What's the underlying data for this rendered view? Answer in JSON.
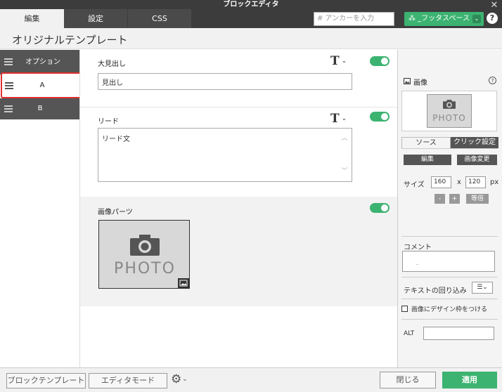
{
  "window": {
    "title": "ブロックエディタ",
    "close_glyph": "✕"
  },
  "tabs": [
    {
      "label": "編集",
      "active": true
    },
    {
      "label": "設定",
      "active": false
    },
    {
      "label": "CSS",
      "active": false
    }
  ],
  "anchor": {
    "placeholder": "# アンカーを入力"
  },
  "footer_space": {
    "label": "⁂ _フッタスペース",
    "chevron": "⌄"
  },
  "help_glyph": "?",
  "page_title": "オリジナルテンプレート",
  "sidebar": {
    "items": [
      {
        "label": "オプション",
        "active": false
      },
      {
        "label": "A",
        "active": true
      },
      {
        "label": "B",
        "active": false
      }
    ]
  },
  "fields": {
    "heading": {
      "label": "大見出し",
      "value": "見出し",
      "enabled": true
    },
    "lead": {
      "label": "リード",
      "value": "リード文",
      "enabled": true
    },
    "image": {
      "label": "画像パーツ",
      "placeholder_text": "PHOTO",
      "enabled": true
    }
  },
  "text_format": {
    "glyph": "T",
    "chevron": "⌄"
  },
  "right_panel": {
    "title": "画像",
    "help_glyph": "?",
    "thumbnail_text": "PHOTO",
    "tabs": {
      "source": "ソース",
      "click": "クリック設定"
    },
    "edit_button": "編集",
    "change_button": "画像変更",
    "size_label": "サイズ",
    "width": "160",
    "x_label": "x",
    "height": "120",
    "unit": "px",
    "minus": "-",
    "plus": "+",
    "equal_scale": "等倍",
    "comment_label": "コメント",
    "comment_value": "..",
    "wrap_label": "テキストの回り込み",
    "wrap_glyph": "☰⌄",
    "frame_label": "画像にデザイン枠をつける",
    "frame_checked": false,
    "alt_label": "ALT",
    "alt_value": ""
  },
  "bottom": {
    "block_template": "ブロックテンプレート",
    "editor_mode": "エディタモード",
    "gear_glyph": "⚙",
    "gear_chevron": "⌄",
    "close": "閉じる",
    "apply": "適用"
  },
  "colors": {
    "accent_green": "#3cb371",
    "dark_bar": "#3c3c3c",
    "sidebar_item": "#555555",
    "selection_red": "#e03030"
  }
}
